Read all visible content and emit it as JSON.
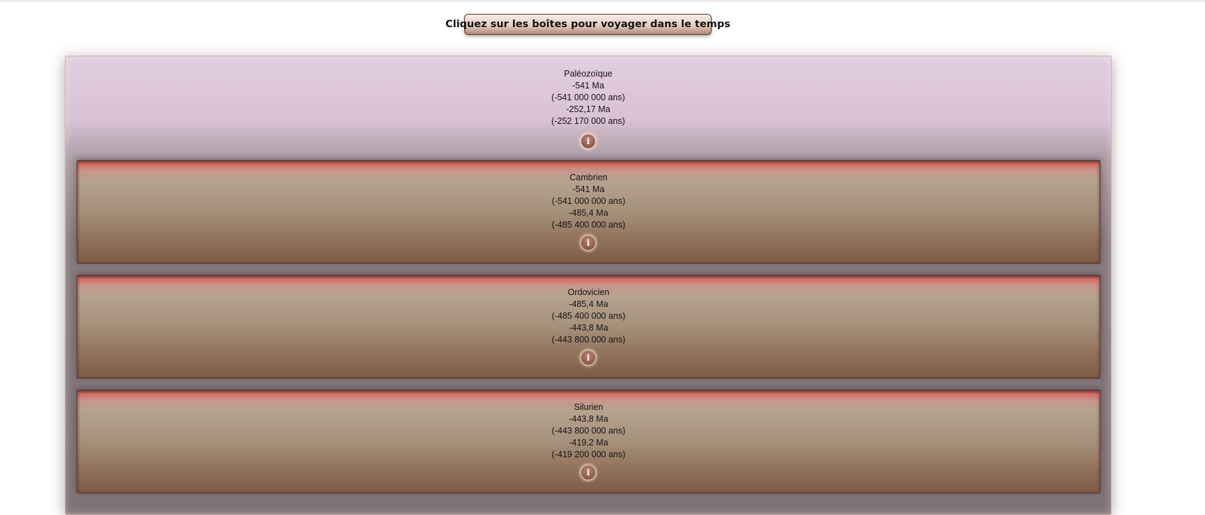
{
  "header": {
    "title_button": "Cliquez sur les boîtes pour voyager dans le temps"
  },
  "era": {
    "name": "Paléozoïque",
    "start_ma": "-541 Ma",
    "start_years": "(-541 000 000 ans)",
    "end_ma": "-252,17 Ma",
    "end_years": "(-252 170 000 ans)",
    "info_icon": "i"
  },
  "periods": [
    {
      "name": "Cambrien",
      "start_ma": "-541 Ma",
      "start_years": "(-541 000 000 ans)",
      "end_ma": "-485,4 Ma",
      "end_years": "(-485 400 000 ans)",
      "info_icon": "i"
    },
    {
      "name": "Ordovicien",
      "start_ma": "-485,4 Ma",
      "start_years": "(-485 400 000 ans)",
      "end_ma": "-443,8 Ma",
      "end_years": "(-443 800 000 ans)",
      "info_icon": "i"
    },
    {
      "name": "Silurien",
      "start_ma": "-443,8 Ma",
      "start_years": "(-443 800 000 ans)",
      "end_ma": "-419,2 Ma",
      "end_years": "(-419 200 000 ans)",
      "info_icon": "i"
    }
  ],
  "colors": {
    "era_background": "#dac2d6",
    "period_background": "#a5907a",
    "period_top_accent": "#d86a62",
    "info_button": "#94604f"
  }
}
